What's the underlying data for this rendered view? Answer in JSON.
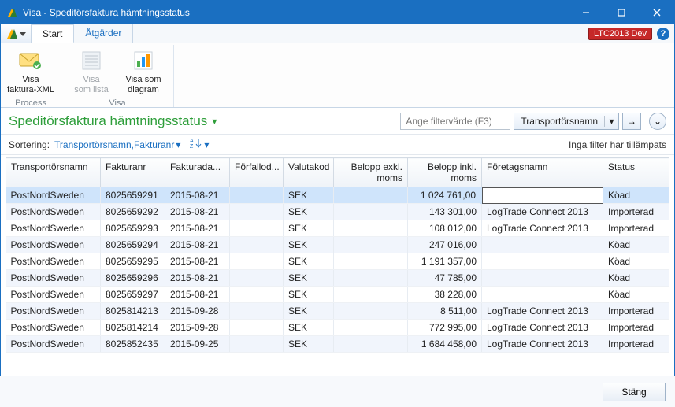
{
  "window": {
    "title": "Visa - Speditörsfaktura hämtningsstatus"
  },
  "env_badge": "LTC2013 Dev",
  "tabs": {
    "start": "Start",
    "actions": "Åtgärder"
  },
  "ribbon": {
    "process_group": "Process",
    "visa_group": "Visa",
    "btn_fakturaxml": "Visa\nfaktura-XML",
    "btn_somlista": "Visa\nsom lista",
    "btn_somdiagram": "Visa som\ndiagram"
  },
  "page_title": "Speditörsfaktura hämtningsstatus",
  "filter": {
    "placeholder": "Ange filtervärde (F3)",
    "combo_label": "Transportörsnamn"
  },
  "sort": {
    "label": "Sortering:",
    "value": "Transportörsnamn,Fakturanr",
    "filter_note": "Inga filter har tillämpats"
  },
  "columns": {
    "c0": "Transportörsnamn",
    "c1": "Fakturanr",
    "c2": "Fakturada...",
    "c3": "Förfallod...",
    "c4": "Valutakod",
    "c5_a": "Belopp exkl.",
    "c5_b": "moms",
    "c6_a": "Belopp inkl.",
    "c6_b": "moms",
    "c7": "Företagsnamn",
    "c8": "Status"
  },
  "rows": [
    {
      "name": "PostNordSweden",
      "nr": "8025659291",
      "date": "2015-08-21",
      "due": "",
      "cur": "SEK",
      "excl": "",
      "incl": "1 024 761,00",
      "corp": "",
      "status": "Köad"
    },
    {
      "name": "PostNordSweden",
      "nr": "8025659292",
      "date": "2015-08-21",
      "due": "",
      "cur": "SEK",
      "excl": "",
      "incl": "143 301,00",
      "corp": "LogTrade Connect 2013",
      "status": "Importerad"
    },
    {
      "name": "PostNordSweden",
      "nr": "8025659293",
      "date": "2015-08-21",
      "due": "",
      "cur": "SEK",
      "excl": "",
      "incl": "108 012,00",
      "corp": "LogTrade Connect 2013",
      "status": "Importerad"
    },
    {
      "name": "PostNordSweden",
      "nr": "8025659294",
      "date": "2015-08-21",
      "due": "",
      "cur": "SEK",
      "excl": "",
      "incl": "247 016,00",
      "corp": "",
      "status": "Köad"
    },
    {
      "name": "PostNordSweden",
      "nr": "8025659295",
      "date": "2015-08-21",
      "due": "",
      "cur": "SEK",
      "excl": "",
      "incl": "1 191 357,00",
      "corp": "",
      "status": "Köad"
    },
    {
      "name": "PostNordSweden",
      "nr": "8025659296",
      "date": "2015-08-21",
      "due": "",
      "cur": "SEK",
      "excl": "",
      "incl": "47 785,00",
      "corp": "",
      "status": "Köad"
    },
    {
      "name": "PostNordSweden",
      "nr": "8025659297",
      "date": "2015-08-21",
      "due": "",
      "cur": "SEK",
      "excl": "",
      "incl": "38 228,00",
      "corp": "",
      "status": "Köad"
    },
    {
      "name": "PostNordSweden",
      "nr": "8025814213",
      "date": "2015-09-28",
      "due": "",
      "cur": "SEK",
      "excl": "",
      "incl": "8 511,00",
      "corp": "LogTrade Connect 2013",
      "status": "Importerad"
    },
    {
      "name": "PostNordSweden",
      "nr": "8025814214",
      "date": "2015-09-28",
      "due": "",
      "cur": "SEK",
      "excl": "",
      "incl": "772 995,00",
      "corp": "LogTrade Connect 2013",
      "status": "Importerad"
    },
    {
      "name": "PostNordSweden",
      "nr": "8025852435",
      "date": "2015-09-25",
      "due": "",
      "cur": "SEK",
      "excl": "",
      "incl": "1 684 458,00",
      "corp": "LogTrade Connect 2013",
      "status": "Importerad"
    }
  ],
  "footer": {
    "close": "Stäng"
  }
}
